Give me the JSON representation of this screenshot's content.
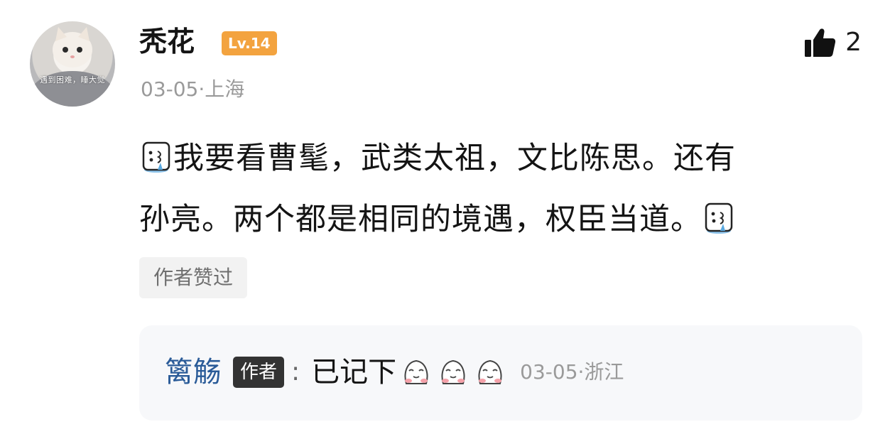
{
  "comment": {
    "user": {
      "name": "秃花",
      "level": "Lv.14",
      "avatar_caption": "遇到困难，睡大觉"
    },
    "meta": "03-05·上海",
    "likes": {
      "icon": "thumbs-up-icon",
      "count": "2"
    },
    "text_line1": "我要看曹髦，武类太祖，文比陈思。还有",
    "text_line2": "孙亮。两个都是相同的境遇，权臣当道。",
    "emoji": "crying-face-emoji",
    "author_liked_label": "作者赞过"
  },
  "reply": {
    "name": "篱觞",
    "author_badge": "作者",
    "colon": ":",
    "text": "已记下",
    "emoji": "blushing-face-emoji",
    "emoji_count": 3,
    "meta": "03-05·浙江"
  },
  "colors": {
    "level_badge": "#f3a33f",
    "reply_name": "#2a5b98",
    "author_badge": "#333333",
    "meta_gray": "#9a9a9a",
    "reply_background": "#f7f8fa"
  }
}
